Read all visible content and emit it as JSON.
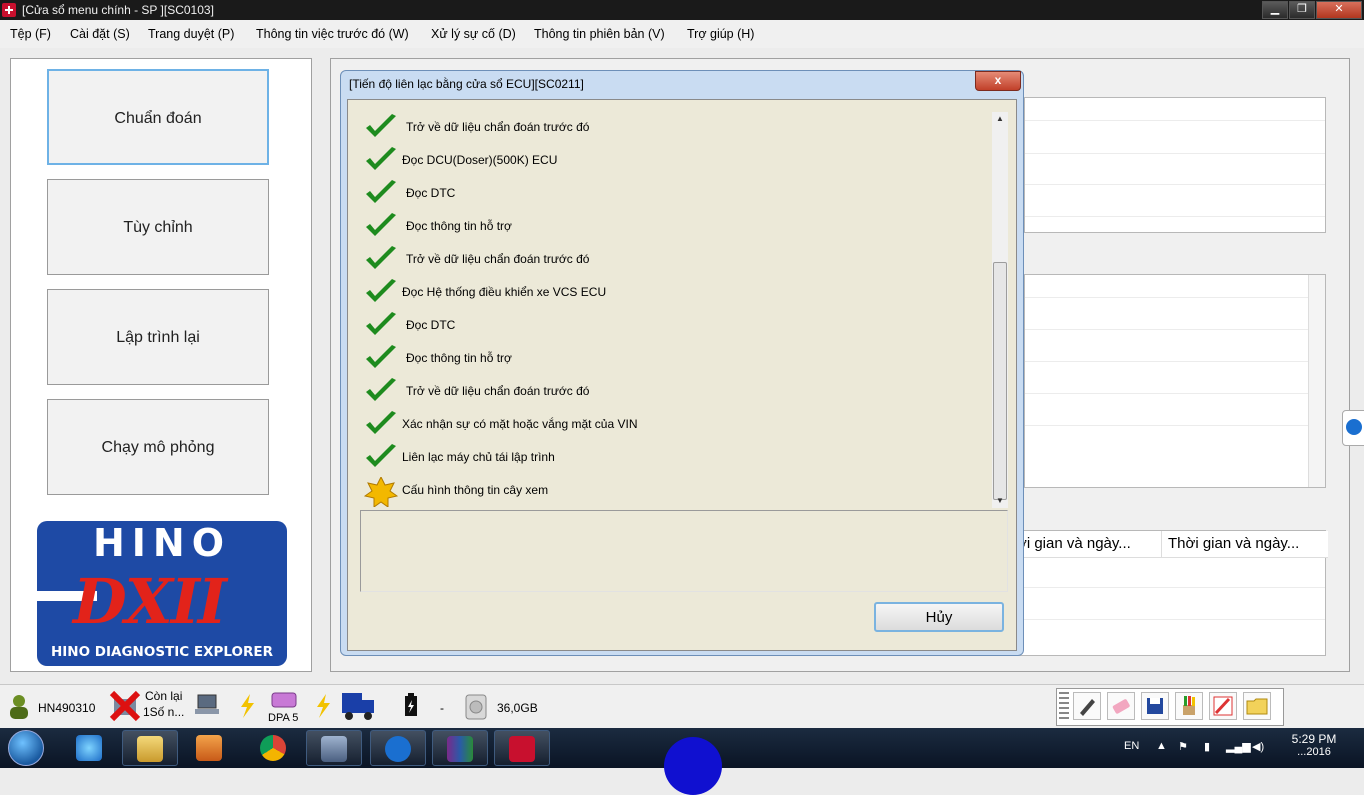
{
  "window": {
    "title": "[Cửa sổ menu chính - SP ][SC0103]"
  },
  "menu": [
    "Tệp (F)",
    "Cài đặt (S)",
    "Trang duyệt (P)",
    "Thông tin việc trước đó (W)",
    "Xử lý sự cố (D)",
    "Thông tin phiên bản (V)",
    "Trợ giúp (H)"
  ],
  "sidebar": {
    "buttons": [
      "Chuẩn đoán",
      "Tùy chỉnh",
      "Lập trình lại",
      "Chạy mô phỏng"
    ],
    "logo": {
      "brand": "HINO",
      "product": "DXII",
      "subtitle": "HINO DIAGNOSTIC EXPLORER"
    }
  },
  "dialog": {
    "title": "[Tiến độ liên lạc bằng cửa sổ ECU][SC0211]",
    "close": "x",
    "steps": [
      {
        "label": "Trở về dữ liệu chẩn đoán trước đó",
        "status": "done"
      },
      {
        "label": "Đọc DCU(Doser)(500K) ECU",
        "status": "done"
      },
      {
        "label": "Đọc DTC",
        "status": "done"
      },
      {
        "label": "Đọc thông tin hỗ trợ",
        "status": "done"
      },
      {
        "label": "Trở về dữ liệu chẩn đoán trước đó",
        "status": "done"
      },
      {
        "label": "Đọc Hệ thống điều khiển xe VCS ECU",
        "status": "done"
      },
      {
        "label": "Đọc DTC",
        "status": "done"
      },
      {
        "label": "Đọc thông tin hỗ trợ",
        "status": "done"
      },
      {
        "label": "Trở về dữ liệu chẩn đoán trước đó",
        "status": "done"
      },
      {
        "label": "Xác nhận sự có mặt hoặc vắng mặt của VIN",
        "status": "done"
      },
      {
        "label": "Liên lạc máy chủ tái lập trình",
        "status": "done"
      },
      {
        "label": "Cấu hình thông tin cây xem",
        "status": "in-progress"
      }
    ],
    "cancel": "Hủy"
  },
  "background": {
    "table_headers": [
      "ời gian và ngày...",
      "Thời gian và ngày..."
    ]
  },
  "status": {
    "user": "HN490310",
    "remaining_line1": "Còn lại",
    "remaining_line2": "1Số n...",
    "dpa": "DPA 5",
    "dash": "-",
    "disk": "36,0GB"
  },
  "taskbar": {
    "lang": "EN",
    "time": "5:29 PM",
    "date": "...2016"
  },
  "colors": {
    "accent": "#1e4aa5",
    "brand_red": "#e2231a",
    "check": "#1e8b1e",
    "pending": "#f3b800"
  }
}
